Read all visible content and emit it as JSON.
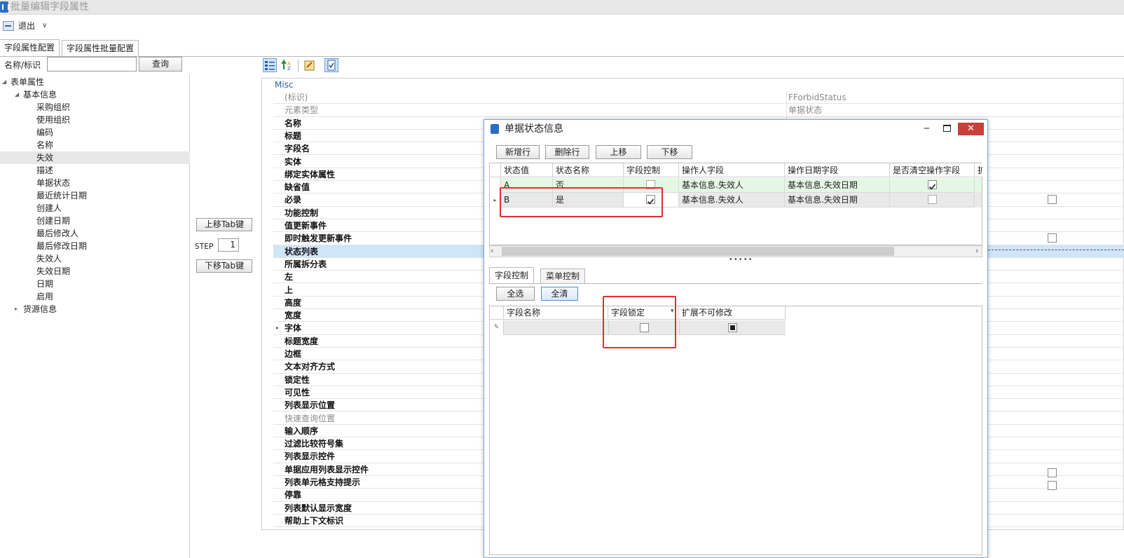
{
  "window": {
    "title": "批量编辑字段属性"
  },
  "toolbar": {
    "exit_label": "退出",
    "exit_caret": "∨"
  },
  "tabs": [
    {
      "label": "字段属性配置"
    },
    {
      "label": "字段属性批量配置"
    }
  ],
  "search": {
    "label": "名称/标识",
    "value": "",
    "button": "查询"
  },
  "tree": {
    "root": "表单属性",
    "group1": "基本信息",
    "items": [
      "采购组织",
      "使用组织",
      "编码",
      "名称",
      "失效",
      "描述",
      "单据状态",
      "最近统计日期",
      "创建人",
      "创建日期",
      "最后修改人",
      "最后修改日期",
      "失效人",
      "失效日期",
      "日期",
      "启用"
    ],
    "selected_item": "失效",
    "group2": "货源信息"
  },
  "middle": {
    "up_button": "上移Tab键",
    "step_label": "STEP",
    "step_value": "1",
    "down_button": "下移Tab键"
  },
  "property_grid": {
    "category": "Misc",
    "rows": [
      {
        "name": "(标识)",
        "value": "FForbidStatus",
        "dim": true
      },
      {
        "name": "元素类型",
        "value": "单据状态",
        "dim": true
      },
      {
        "name": "名称",
        "value": ""
      },
      {
        "name": "标题",
        "value": ""
      },
      {
        "name": "字段名",
        "value": ""
      },
      {
        "name": "实体",
        "value": ""
      },
      {
        "name": "绑定实体属性",
        "value": ""
      },
      {
        "name": "缺省值",
        "value": ""
      },
      {
        "name": "必录",
        "value": ""
      },
      {
        "name": "功能控制",
        "value": ""
      },
      {
        "name": "值更新事件",
        "value": ""
      },
      {
        "name": "即时触发更新事件",
        "value": ""
      },
      {
        "name": "状态列表",
        "value": "",
        "selected": true
      },
      {
        "name": "所属拆分表",
        "value": ""
      },
      {
        "name": "左",
        "value": ""
      },
      {
        "name": "上",
        "value": ""
      },
      {
        "name": "高度",
        "value": ""
      },
      {
        "name": "宽度",
        "value": ""
      },
      {
        "name": "字体",
        "value": "",
        "expandable": true
      },
      {
        "name": "标题宽度",
        "value": ""
      },
      {
        "name": "边框",
        "value": ""
      },
      {
        "name": "文本对齐方式",
        "value": ""
      },
      {
        "name": "锁定性",
        "value": ""
      },
      {
        "name": "可见性",
        "value": ""
      },
      {
        "name": "列表显示位置",
        "value": ""
      },
      {
        "name": "快速查询位置",
        "value": "",
        "dim": true
      },
      {
        "name": "输入顺序",
        "value": ""
      },
      {
        "name": "过滤比较符号集",
        "value": ""
      },
      {
        "name": "列表显示控件",
        "value": ""
      },
      {
        "name": "单据应用列表显示控件",
        "value": ""
      },
      {
        "name": "列表单元格支持提示",
        "value": ""
      },
      {
        "name": "停靠",
        "value": ""
      },
      {
        "name": "列表默认显示宽度",
        "value": ""
      },
      {
        "name": "帮助上下文标识",
        "value": ""
      }
    ]
  },
  "dialog": {
    "title": "单据状态信息",
    "buttons": {
      "add_row": "新增行",
      "delete_row": "删除行",
      "move_up": "上移",
      "move_down": "下移"
    },
    "grid_columns": [
      "状态值",
      "状态名称",
      "字段控制",
      "操作人字段",
      "操作日期字段",
      "是否清空操作字段",
      "扩."
    ],
    "grid_rows": [
      {
        "value": "A",
        "name": "否",
        "field_control": false,
        "operator": "基本信息.失效人",
        "date_field": "基本信息.失效日期",
        "clear": true
      },
      {
        "value": "B",
        "name": "是",
        "field_control": true,
        "operator": "基本信息.失效人",
        "date_field": "基本信息.失效日期",
        "clear": false
      }
    ],
    "splitter": "•••••",
    "lower_tabs": [
      "字段控制",
      "菜单控制"
    ],
    "lower_buttons": {
      "select_all": "全选",
      "clear_all": "全清"
    },
    "lower_columns": [
      "字段名称",
      "字段锁定",
      "扩展不可修改"
    ]
  },
  "colors": {
    "highlight_red": "#e03030",
    "selected_row": "#cfe5f8",
    "green_row": "#e4f7e4",
    "close_red": "#c7403a"
  }
}
